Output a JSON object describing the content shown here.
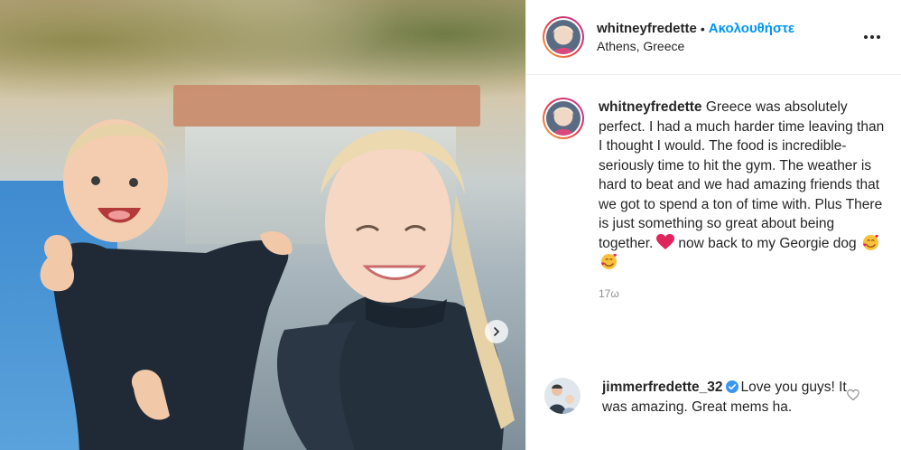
{
  "post": {
    "image_alt": "Photo of a woman holding a smiling baby outdoors",
    "carousel_next_icon": "chevron-right-icon"
  },
  "header": {
    "username": "whitneyfredette",
    "dot": "•",
    "follow_label": "Ακολουθήστε",
    "location": "Athens, Greece",
    "more_label": "•••"
  },
  "caption": {
    "username": "whitneyfredette",
    "text_part1": "Greece was absolutely perfect. I had a much harder time leaving than I thought I would. The food is incredible- seriously time to hit the gym. The weather is hard to beat and we had amazing friends that we got to spend a ton of time with. Plus There is just something so great about being together.",
    "text_part2": "now back to my Georgie dog",
    "emojis": [
      "heart-emoji",
      "smiling-face-with-hearts-emoji",
      "smiling-face-with-hearts-emoji"
    ],
    "time": "17ω"
  },
  "comments": [
    {
      "username": "jimmerfredette_32",
      "verified_icon": "verified-badge-icon",
      "text": "Love you guys! It was amazing. Great mems ha.",
      "like_icon": "heart-outline-icon"
    }
  ],
  "colors": {
    "follow": "#0095f6",
    "text": "#262626",
    "secondary": "#8e8e8e",
    "verified": "#3897f0",
    "heart_emoji": "#e0245e"
  }
}
